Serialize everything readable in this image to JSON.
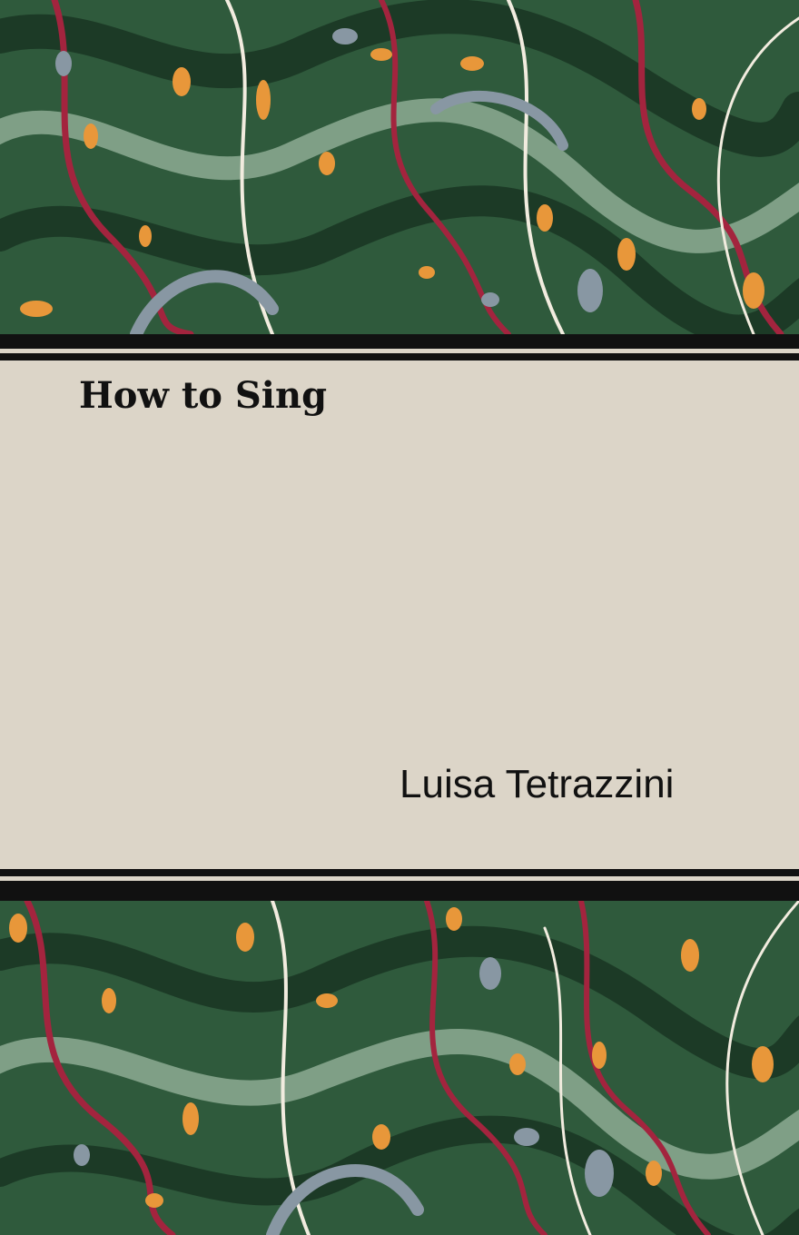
{
  "book": {
    "title": "How to Sing",
    "author": "Luisa Tetrazzini"
  },
  "colors": {
    "panel": "#dcd5c8",
    "band": "#111111",
    "marble_green": "#2f5a3c",
    "marble_dark": "#1c3a26",
    "marble_sage": "#7f9f86",
    "marble_crimson": "#a3243e",
    "marble_orange": "#e8973a",
    "marble_slate": "#8897a3",
    "marble_cream": "#f2ecdf"
  },
  "decoration": {
    "top": "marbled-paper-pattern",
    "bottom": "marbled-paper-pattern"
  }
}
